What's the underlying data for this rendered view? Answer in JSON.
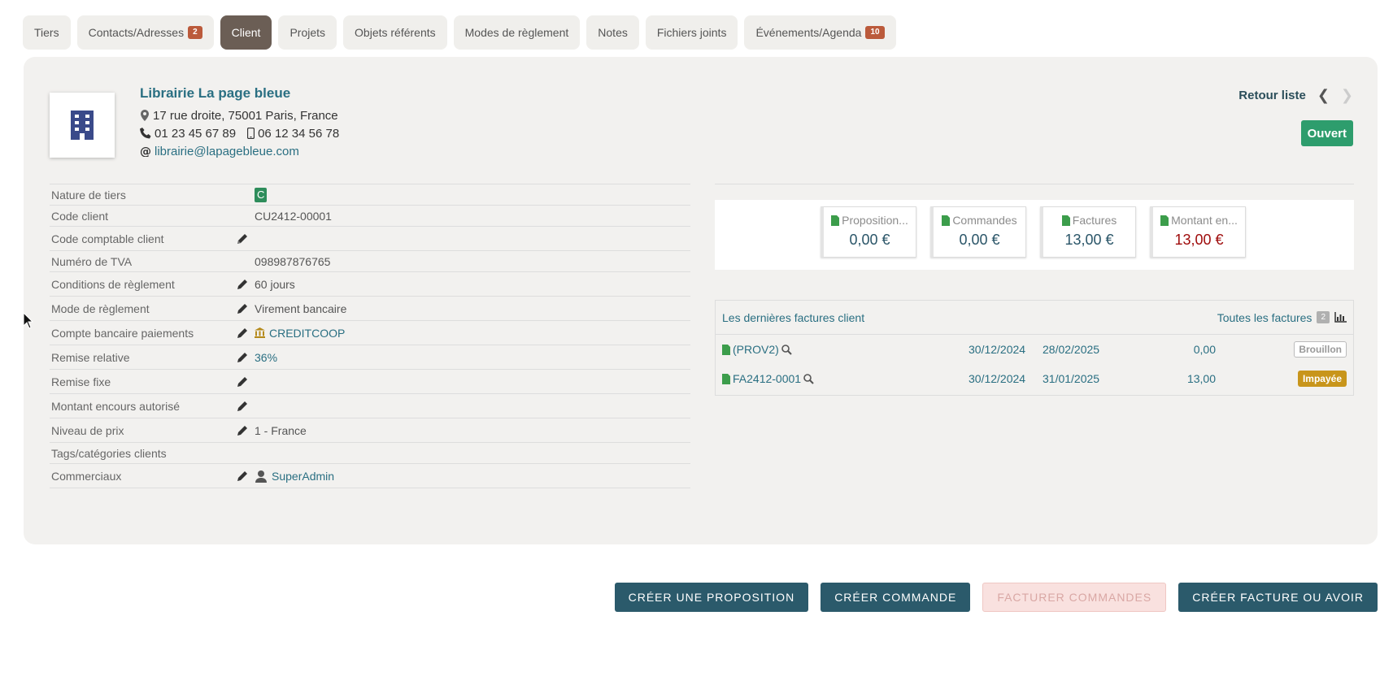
{
  "tabs": [
    {
      "label": "Tiers"
    },
    {
      "label": "Contacts/Adresses",
      "badge": "2"
    },
    {
      "label": "Client",
      "active": true
    },
    {
      "label": "Projets"
    },
    {
      "label": "Objets référents"
    },
    {
      "label": "Modes de règlement"
    },
    {
      "label": "Notes"
    },
    {
      "label": "Fichiers joints"
    },
    {
      "label": "Événements/Agenda",
      "badge": "10"
    }
  ],
  "company": {
    "name": "Librairie La page bleue",
    "address": "17 rue droite, 75001 Paris, France",
    "phone": "01 23 45 67 89",
    "mobile": "06 12 34 56 78",
    "email": "librairie@lapagebleue.com",
    "logo_icon": "building-icon"
  },
  "nav": {
    "back_label": "Retour liste",
    "prev_icon": "chevron-left-icon",
    "next_icon": "chevron-right-icon"
  },
  "status": "Ouvert",
  "fields": [
    {
      "label": "Nature de tiers",
      "value": "C",
      "badge": true,
      "editable": false
    },
    {
      "label": "Code client",
      "value": "CU2412-00001",
      "editable": false
    },
    {
      "label": "Code comptable client",
      "value": "",
      "editable": true
    },
    {
      "label": "Numéro de TVA",
      "value": "098987876765",
      "editable": false
    },
    {
      "label": "Conditions de règlement",
      "value": "60 jours",
      "editable": true
    },
    {
      "label": "Mode de règlement",
      "value": "Virement bancaire",
      "editable": true
    },
    {
      "label": "Compte bancaire paiements",
      "value": "CREDITCOOP",
      "editable": true,
      "link": true,
      "icon": "bank-icon"
    },
    {
      "label": "Remise relative",
      "value": "36%",
      "editable": true,
      "link": true
    },
    {
      "label": "Remise fixe",
      "value": "",
      "editable": true
    },
    {
      "label": "Montant encours autorisé",
      "value": "",
      "editable": true
    },
    {
      "label": "Niveau de prix",
      "value": "1 - France",
      "editable": true
    },
    {
      "label": "Tags/catégories clients",
      "value": "",
      "editable": false
    },
    {
      "label": "Commerciaux",
      "value": "SuperAdmin",
      "editable": true,
      "link": true,
      "icon": "user-icon"
    }
  ],
  "stats": [
    {
      "label": "Proposition...",
      "value": "0,00 €",
      "red": false
    },
    {
      "label": "Commandes",
      "value": "0,00 €",
      "red": false
    },
    {
      "label": "Factures",
      "value": "13,00 €",
      "red": false
    },
    {
      "label": "Montant en...",
      "value": "13,00 €",
      "red": true
    }
  ],
  "invoices": {
    "title": "Les dernières factures client",
    "all_label": "Toutes les factures",
    "count": "2",
    "rows": [
      {
        "ref": "(PROV2)",
        "date": "30/12/2024",
        "due": "28/02/2025",
        "amount": "0,00",
        "status": "Brouillon",
        "status_type": "draft"
      },
      {
        "ref": "FA2412-0001",
        "date": "30/12/2024",
        "due": "31/01/2025",
        "amount": "13,00",
        "status": "Impayée",
        "status_type": "unpaid"
      }
    ]
  },
  "actions": [
    {
      "label": "CRÉER UNE PROPOSITION",
      "disabled": false
    },
    {
      "label": "CRÉER COMMANDE",
      "disabled": false
    },
    {
      "label": "FACTURER COMMANDES",
      "disabled": true
    },
    {
      "label": "CRÉER FACTURE OU AVOIR",
      "disabled": false
    }
  ],
  "colors": {
    "accent": "#2a6f82",
    "active_tab": "#6b5e55",
    "button": "#2b5a6b",
    "open": "#2e9d6d",
    "unpaid": "#c8951b",
    "badge": "#bb5a3b"
  }
}
